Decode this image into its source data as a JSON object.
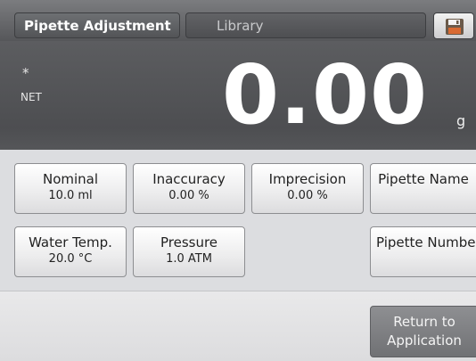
{
  "header": {
    "tab_active": "Pipette Adjustment",
    "tab_library": "Library",
    "save_icon": "floppy-disk-icon"
  },
  "display": {
    "stability_mark": "*",
    "net_label": "NET",
    "value": "0.00",
    "unit": "g"
  },
  "params": {
    "nominal": {
      "label": "Nominal",
      "value": "10.0 ml"
    },
    "inaccuracy": {
      "label": "Inaccuracy",
      "value": "0.00 %"
    },
    "imprecision": {
      "label": "Imprecision",
      "value": "0.00 %"
    },
    "pipette_name": {
      "label": "Pipette Name"
    },
    "water_temp": {
      "label": "Water Temp.",
      "value": "20.0 °C"
    },
    "pressure": {
      "label": "Pressure",
      "value": "1.0 ATM"
    },
    "pipette_number": {
      "label": "Pipette Number"
    }
  },
  "footer": {
    "return_line1": "Return to",
    "return_line2": "Application"
  },
  "colors": {
    "header_bg": "#56575a",
    "display_bg": "#555659",
    "button_bg": "#ececed",
    "return_bg": "#7f8083"
  }
}
